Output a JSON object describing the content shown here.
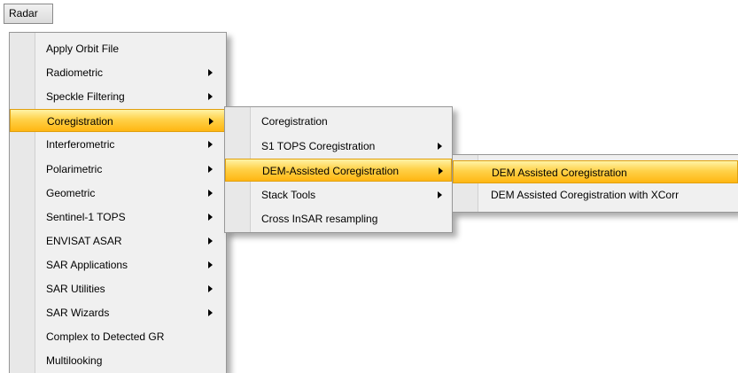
{
  "menubar": {
    "radar_label": "Radar"
  },
  "menu1": {
    "items": [
      {
        "label": "Apply Orbit File",
        "submenu": false
      },
      {
        "label": "Radiometric",
        "submenu": true
      },
      {
        "label": "Speckle Filtering",
        "submenu": true
      },
      {
        "label": "Coregistration",
        "submenu": true,
        "highlighted": true
      },
      {
        "label": "Interferometric",
        "submenu": true
      },
      {
        "label": "Polarimetric",
        "submenu": true
      },
      {
        "label": "Geometric",
        "submenu": true
      },
      {
        "label": "Sentinel-1 TOPS",
        "submenu": true
      },
      {
        "label": "ENVISAT ASAR",
        "submenu": true
      },
      {
        "label": "SAR Applications",
        "submenu": true
      },
      {
        "label": "SAR Utilities",
        "submenu": true
      },
      {
        "label": "SAR Wizards",
        "submenu": true
      },
      {
        "label": "Complex to Detected GR",
        "submenu": false
      },
      {
        "label": "Multilooking",
        "submenu": false
      }
    ]
  },
  "menu2": {
    "items": [
      {
        "label": "Coregistration",
        "submenu": false
      },
      {
        "label": "S1 TOPS Coregistration",
        "submenu": true
      },
      {
        "label": "DEM-Assisted Coregistration",
        "submenu": true,
        "highlighted": true
      },
      {
        "label": "Stack Tools",
        "submenu": true
      },
      {
        "label": "Cross InSAR resampling",
        "submenu": false
      }
    ]
  },
  "menu3": {
    "items": [
      {
        "label": "DEM Assisted Coregistration",
        "submenu": false,
        "highlighted": true
      },
      {
        "label": "DEM Assisted Coregistration with XCorr",
        "submenu": false
      }
    ]
  },
  "colors": {
    "highlight_top": "#fff3a6",
    "highlight_bottom": "#ffb612",
    "menu_bg": "#f0f0f0"
  }
}
